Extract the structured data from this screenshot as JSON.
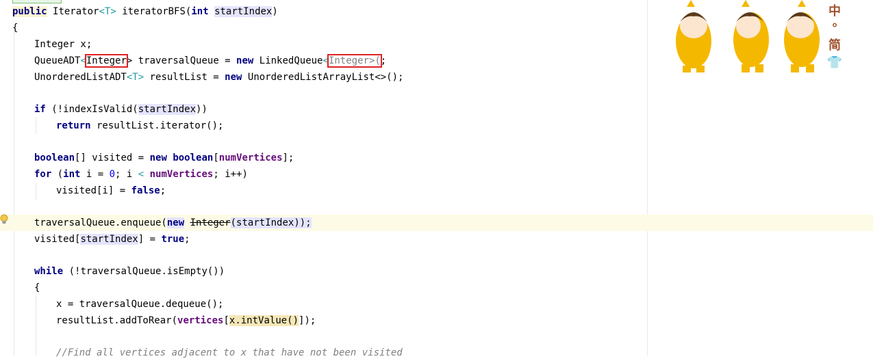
{
  "editor": {
    "lines": {
      "l1": {
        "kw": "public",
        "type": "Iterator",
        "lt": "<",
        "T": "T",
        "gt": ">",
        "method": " iteratorBFS(",
        "int": "int",
        "param": "startIndex",
        "close": ")"
      },
      "l2": "{",
      "l3": "Integer x;",
      "l4": {
        "a": "QueueADT",
        "lt": "<",
        "boxed1": "Integer",
        "b": "> traversalQueue = ",
        "new": "new",
        "c": " LinkedQueue",
        "lt2": "<",
        "boxed2": "Integer>(",
        "d": ";"
      },
      "l5": {
        "a": "UnorderedListADT",
        "gen": "<T>",
        "b": " resultList = ",
        "new": "new",
        "c": " UnorderedListArrayList<>();"
      },
      "l6": {
        "if": "if",
        "a": " (!indexIsValid(",
        "param": "startIndex",
        "b": "))"
      },
      "l7": {
        "ret": "return",
        "a": " resultList.iterator();"
      },
      "l8": {
        "bool": "boolean",
        "a": "[] visited = ",
        "new": "new",
        "bool2": "boolean",
        "b": "[",
        "field": "numVertices",
        "c": "];"
      },
      "l9": {
        "for": "for",
        "a": " (",
        "int": "int",
        "b": " i = ",
        "zero": "0",
        "c": "; i ",
        "lt": "<",
        "d": " ",
        "field": "numVertices",
        "e": "; i++)"
      },
      "l10": {
        "a": "visited[i] = ",
        "false": "false",
        "b": ";"
      },
      "l11": {
        "a": "traversalQueue.enqueue(",
        "new": "new",
        "b": " ",
        "strike": "Integer",
        "c": "(startIndex));"
      },
      "l12": {
        "a": "visited[",
        "param": "startIndex",
        "b": "] = ",
        "true": "true",
        "c": ";"
      },
      "l13": {
        "while": "while",
        "a": " (!traversalQueue.isEmpty())"
      },
      "l14": "{",
      "l15": "x = traversalQueue.dequeue();",
      "l16": {
        "a": "resultList.addToRear(",
        "field": "vertices",
        "b": "[",
        "usage": "x.intValue()",
        "c": "]);"
      },
      "l17": "//Find all vertices adjacent to x that have not been visited"
    }
  },
  "side_toolbar": {
    "btn1": "中",
    "btn2": "°",
    "btn3": "简",
    "btn4": "👕"
  },
  "colors": {
    "keyword": "#000080",
    "field": "#660e7a",
    "number": "#0000ff",
    "generic": "#20999d",
    "comment": "#808080",
    "highlight_box": "#e02020"
  }
}
